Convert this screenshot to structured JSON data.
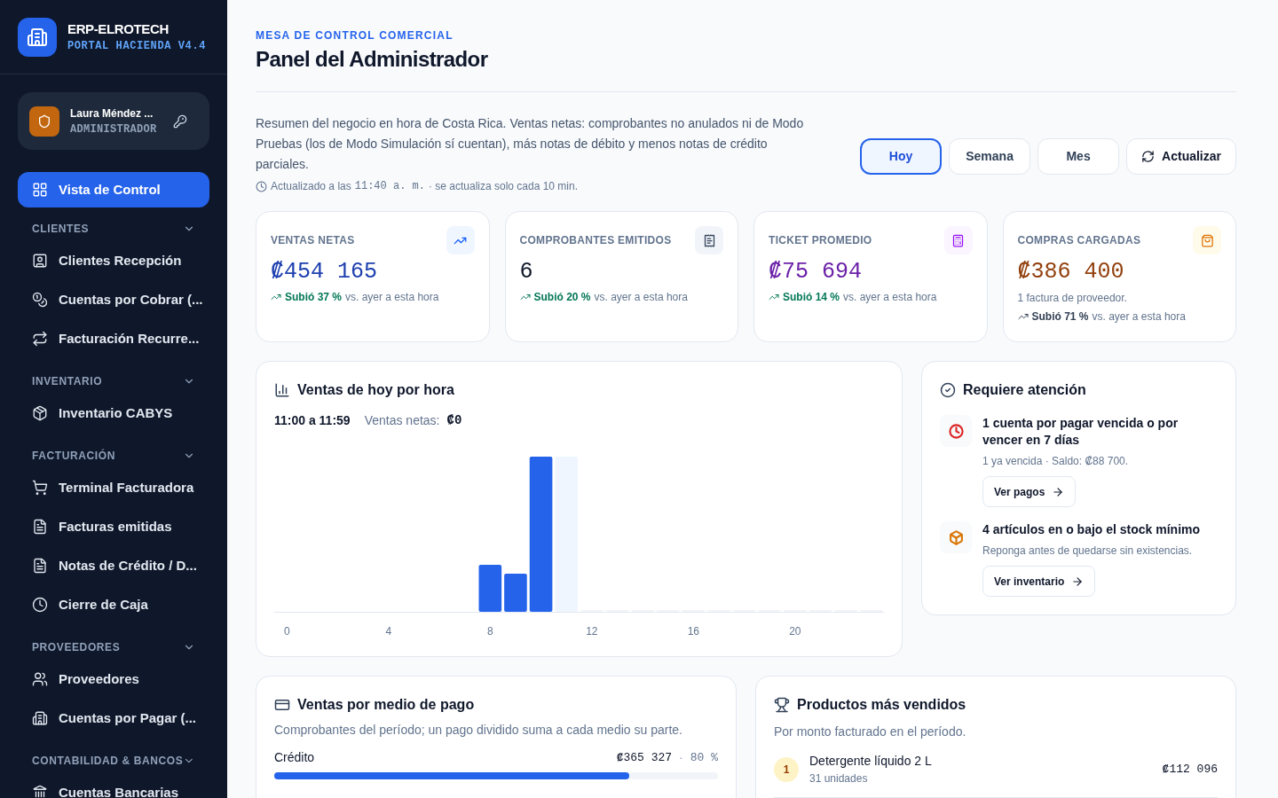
{
  "brand": {
    "name": "ERP-ELROTECH",
    "subtitle": "PORTAL HACIENDA V4.4"
  },
  "user": {
    "name": "Laura Méndez ...",
    "role": "ADMINISTRADOR"
  },
  "sidebar": {
    "top_item": {
      "label": "Vista de Control",
      "selected": true
    },
    "sections": [
      {
        "title": "CLIENTES",
        "expanded": true,
        "items": [
          {
            "label": "Clientes Recepción",
            "selected": false
          },
          {
            "label": "Cuentas por Cobrar (...",
            "selected": false
          },
          {
            "label": "Facturación Recurre...",
            "selected": false
          }
        ]
      },
      {
        "title": "INVENTARIO",
        "expanded": true,
        "items": [
          {
            "label": "Inventario CABYS",
            "selected": false
          }
        ]
      },
      {
        "title": "FACTURACIÓN",
        "expanded": true,
        "items": [
          {
            "label": "Terminal Facturadora",
            "selected": false
          },
          {
            "label": "Facturas emitidas",
            "selected": false
          },
          {
            "label": "Notas de Crédito / D...",
            "selected": false
          },
          {
            "label": "Cierre de Caja",
            "selected": false
          }
        ]
      },
      {
        "title": "PROVEEDORES",
        "expanded": true,
        "items": [
          {
            "label": "Proveedores",
            "selected": false
          },
          {
            "label": "Cuentas por Pagar (...",
            "selected": false
          }
        ]
      },
      {
        "title": "CONTABILIDAD & BANCOS",
        "expanded": true,
        "items": [
          {
            "label": "Cuentas Bancarias",
            "selected": false
          }
        ]
      }
    ]
  },
  "header": {
    "eyebrow": "MESA DE CONTROL COMERCIAL",
    "title": "Panel del Administrador"
  },
  "summary": {
    "text": "Resumen del negocio en hora de Costa Rica. Ventas netas: comprobantes no anulados ni de Modo Pruebas (los de Modo Simulación sí cuentan), más notas de débito y menos notas de crédito parciales.",
    "updated_prefix": "Actualizado a las",
    "updated_time": "11:40 a. m.",
    "updated_suffix": "· se actualiza solo cada 10 min."
  },
  "periods": [
    {
      "label": "Hoy",
      "selected": true
    },
    {
      "label": "Semana",
      "selected": false
    },
    {
      "label": "Mes",
      "selected": false
    }
  ],
  "refresh_button": "Actualizar",
  "kpis": [
    {
      "title": "VENTAS NETAS",
      "value": "₡454 165",
      "color": "#1e40af",
      "trend": {
        "text": "Subió 37 %",
        "color": "#047857"
      },
      "trend_note": "vs. ayer a esta hora"
    },
    {
      "title": "COMPROBANTES EMITIDOS",
      "value": "6",
      "color": "#0f172a",
      "trend": {
        "text": "Subió 20 %",
        "color": "#047857"
      },
      "trend_note": "vs. ayer a esta hora"
    },
    {
      "title": "TICKET PROMEDIO",
      "value": "₡75 694",
      "color": "#6b21a8",
      "trend": {
        "text": "Subió 14 %",
        "color": "#047857"
      },
      "trend_note": "vs. ayer a esta hora"
    },
    {
      "title": "COMPRAS CARGADAS",
      "value": "₡386 400",
      "color": "#92400e",
      "note": "1 factura de proveedor.",
      "trend": {
        "text": "Subió 71 %",
        "color": "#334155"
      },
      "trend_note": "vs. ayer a esta hora"
    }
  ],
  "hourly_chart": {
    "title": "Ventas de hoy por hora",
    "range": "11:00 a 11:59",
    "label": "Ventas netas:",
    "value": "₡0",
    "x_labels": [
      "0",
      "4",
      "8",
      "12",
      "16",
      "20"
    ]
  },
  "attention": {
    "title": "Requiere atención",
    "items": [
      {
        "title": "1 cuenta por pagar vencida o por vencer en 7 días",
        "detail": "1 ya vencida · Saldo: ₡88 700.",
        "action": "Ver pagos",
        "color": "#dc2626"
      },
      {
        "title": "4 artículos en o bajo el stock mínimo",
        "detail": "Reponga antes de quedarse sin existencias.",
        "action": "Ver inventario",
        "color": "#d97706"
      }
    ]
  },
  "payments": {
    "title": "Ventas por medio de pago",
    "subtitle": "Comprobantes del período; un pago dividido suma a cada medio su parte.",
    "rows": [
      {
        "label": "Crédito",
        "amount": "₡365 327",
        "separator": "·",
        "share": "80 %",
        "level": 0.8
      }
    ]
  },
  "products": {
    "title": "Productos más vendidos",
    "subtitle": "Por monto facturado en el período.",
    "rows": [
      {
        "rank": "1",
        "name": "Detergente líquido 2 L",
        "units": "31 unidades",
        "amount": "₡112 096"
      }
    ]
  }
}
